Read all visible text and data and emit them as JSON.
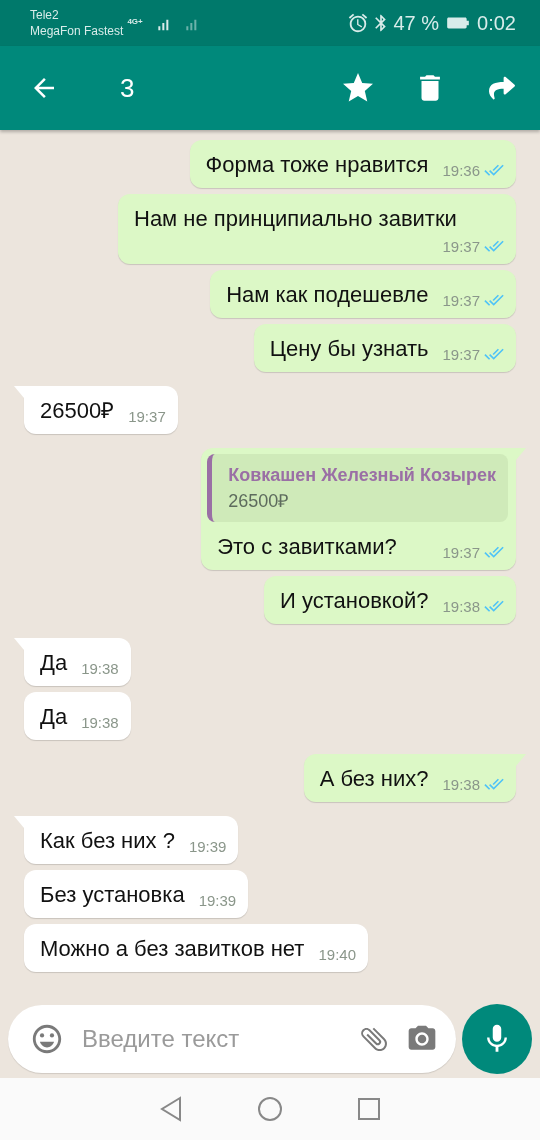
{
  "status_bar": {
    "carrier_1": "Tele2",
    "carrier_2": "MegaFon Fastest",
    "network": "4G+",
    "battery": "47 %",
    "time": "0:02"
  },
  "app_bar": {
    "selected_count": "3"
  },
  "messages": [
    {
      "kind": "outgoing",
      "tail": false,
      "text": "Форма тоже нравится",
      "time": "19:36",
      "read": true
    },
    {
      "kind": "outgoing",
      "tail": false,
      "text": "Нам не принципиально завитки",
      "time": "19:37",
      "read": true
    },
    {
      "kind": "outgoing",
      "tail": false,
      "text": "Нам как подешевле",
      "time": "19:37",
      "read": true
    },
    {
      "kind": "outgoing",
      "tail": false,
      "text": "Цену бы узнать",
      "time": "19:37",
      "read": true
    },
    {
      "kind": "incoming",
      "tail": true,
      "text": "26500₽",
      "time": "19:37"
    },
    {
      "kind": "outgoing",
      "tail": true,
      "quote": {
        "author": "Ковкашен Железный Козырек",
        "text": "26500₽"
      },
      "text": "Это с завитками?",
      "time": "19:37",
      "read": true
    },
    {
      "kind": "outgoing",
      "tail": false,
      "text": "И установкой?",
      "time": "19:38",
      "read": true
    },
    {
      "kind": "incoming",
      "tail": true,
      "text": "Да",
      "time": "19:38"
    },
    {
      "kind": "incoming",
      "tail": false,
      "text": "Да",
      "time": "19:38"
    },
    {
      "kind": "outgoing",
      "tail": true,
      "text": "А без них?",
      "time": "19:38",
      "read": true
    },
    {
      "kind": "incoming",
      "tail": true,
      "text": "Как без них ?",
      "time": "19:39"
    },
    {
      "kind": "incoming",
      "tail": false,
      "text": "Без установка",
      "time": "19:39"
    },
    {
      "kind": "incoming",
      "tail": false,
      "text": "Можно а без завитков нет",
      "time": "19:40"
    }
  ],
  "composer": {
    "placeholder": "Введите текст"
  }
}
